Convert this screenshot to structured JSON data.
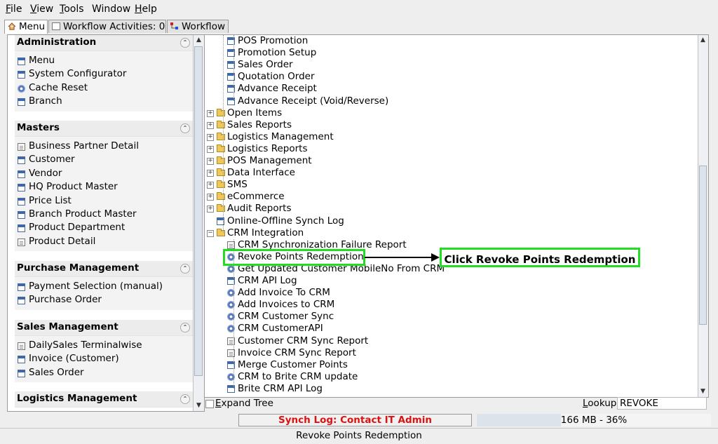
{
  "menubar": [
    {
      "label": "File",
      "accel": "F",
      "rest": "ile"
    },
    {
      "label": "View",
      "accel": "V",
      "rest": "iew"
    },
    {
      "label": "Tools",
      "accel": "T",
      "rest": "ools"
    },
    {
      "label": "Window",
      "accel": "",
      "rest": "Window"
    },
    {
      "label": "Help",
      "accel": "H",
      "rest": "elp"
    }
  ],
  "tabs": [
    {
      "label": "Menu",
      "icon": "home-icon"
    },
    {
      "label": "Workflow Activities: 0",
      "icon": "activities-icon"
    },
    {
      "label": "Workflow",
      "icon": "workflow-icon"
    }
  ],
  "left": {
    "sections": [
      {
        "title": "Administration",
        "items": [
          {
            "label": "Menu",
            "icon": "window"
          },
          {
            "label": "System Configurator",
            "icon": "window"
          },
          {
            "label": "Cache Reset",
            "icon": "process"
          },
          {
            "label": "Branch",
            "icon": "window"
          }
        ]
      },
      {
        "title": "Masters",
        "items": [
          {
            "label": "Business Partner Detail",
            "icon": "form"
          },
          {
            "label": "Customer",
            "icon": "window"
          },
          {
            "label": "Vendor",
            "icon": "window"
          },
          {
            "label": "HQ Product Master",
            "icon": "window"
          },
          {
            "label": "Price List",
            "icon": "window"
          },
          {
            "label": "Branch Product Master",
            "icon": "window"
          },
          {
            "label": "Product Department",
            "icon": "window"
          },
          {
            "label": "Product Detail",
            "icon": "form"
          }
        ]
      },
      {
        "title": "Purchase Management",
        "items": [
          {
            "label": "Payment Selection (manual)",
            "icon": "window"
          },
          {
            "label": "Purchase Order",
            "icon": "window"
          }
        ]
      },
      {
        "title": "Sales Management",
        "items": [
          {
            "label": "DailySales Terminalwise",
            "icon": "form"
          },
          {
            "label": "Invoice (Customer)",
            "icon": "window"
          },
          {
            "label": "Sales Order",
            "icon": "window"
          }
        ]
      },
      {
        "title": "Logistics Management",
        "items": []
      }
    ]
  },
  "tree": {
    "nodes": [
      {
        "label": "POS Promotion",
        "kind": "window",
        "level": 2
      },
      {
        "label": "Promotion Setup",
        "kind": "window",
        "level": 2
      },
      {
        "label": "Sales Order",
        "kind": "window",
        "level": 2
      },
      {
        "label": "Quotation Order",
        "kind": "window",
        "level": 2
      },
      {
        "label": "Advance Receipt",
        "kind": "window",
        "level": 2
      },
      {
        "label": "Advance Receipt (Void/Reverse)",
        "kind": "window",
        "level": 2
      },
      {
        "label": "Open Items",
        "kind": "folder",
        "level": 1
      },
      {
        "label": "Sales Reports",
        "kind": "folder",
        "level": 1
      },
      {
        "label": "Logistics Management",
        "kind": "folder",
        "level": 1
      },
      {
        "label": "Logistics Reports",
        "kind": "folder",
        "level": 1
      },
      {
        "label": "POS Management",
        "kind": "folder",
        "level": 1
      },
      {
        "label": "Data Interface",
        "kind": "folder",
        "level": 1
      },
      {
        "label": "SMS",
        "kind": "folder",
        "level": 1
      },
      {
        "label": "eCommerce",
        "kind": "folder",
        "level": 1
      },
      {
        "label": "Audit Reports",
        "kind": "folder",
        "level": 1
      },
      {
        "label": "Online-Offline Synch Log",
        "kind": "window",
        "level": 1
      },
      {
        "label": "CRM Integration",
        "kind": "folder-open",
        "level": 1
      },
      {
        "label": "CRM Synchronization Failure Report",
        "kind": "form",
        "level": 2
      },
      {
        "label": "Revoke Points Redemption",
        "kind": "process",
        "level": 2
      },
      {
        "label": "Get Updated Customer MobileNo From CRM",
        "kind": "process",
        "level": 2
      },
      {
        "label": "CRM API Log",
        "kind": "window",
        "level": 2
      },
      {
        "label": "Add Invoice To CRM",
        "kind": "process",
        "level": 2
      },
      {
        "label": "Add Invoices to CRM",
        "kind": "process",
        "level": 2
      },
      {
        "label": "CRM Customer Sync",
        "kind": "process",
        "level": 2
      },
      {
        "label": "CRM CustomerAPI",
        "kind": "process",
        "level": 2
      },
      {
        "label": "Customer CRM Sync Report",
        "kind": "form",
        "level": 2
      },
      {
        "label": "Invoice CRM Sync Report",
        "kind": "form",
        "level": 2
      },
      {
        "label": "Merge Customer Points",
        "kind": "window",
        "level": 2
      },
      {
        "label": "CRM to Brite CRM update",
        "kind": "process",
        "level": 2
      },
      {
        "label": "Brite CRM API Log",
        "kind": "window",
        "level": 2
      }
    ],
    "highlighted_index": 18
  },
  "callout": {
    "text": "Click Revoke Points Redemption",
    "border_color": "#22dd22"
  },
  "bottom": {
    "expand_tree_label": "Expand Tree",
    "expand_accel": "E",
    "expand_rest": "xpand Tree",
    "lookup_label": "Lookup",
    "lookup_accel": "L",
    "lookup_rest": "ookup",
    "lookup_value": "REVOKE"
  },
  "status": {
    "synch_text": "Synch Log: Contact IT Admin",
    "synch_color": "#dd1111",
    "memory_text": "166 MB - 36%",
    "memory_fraction": 0.36
  },
  "footer": {
    "text": "Revoke Points Redemption"
  }
}
